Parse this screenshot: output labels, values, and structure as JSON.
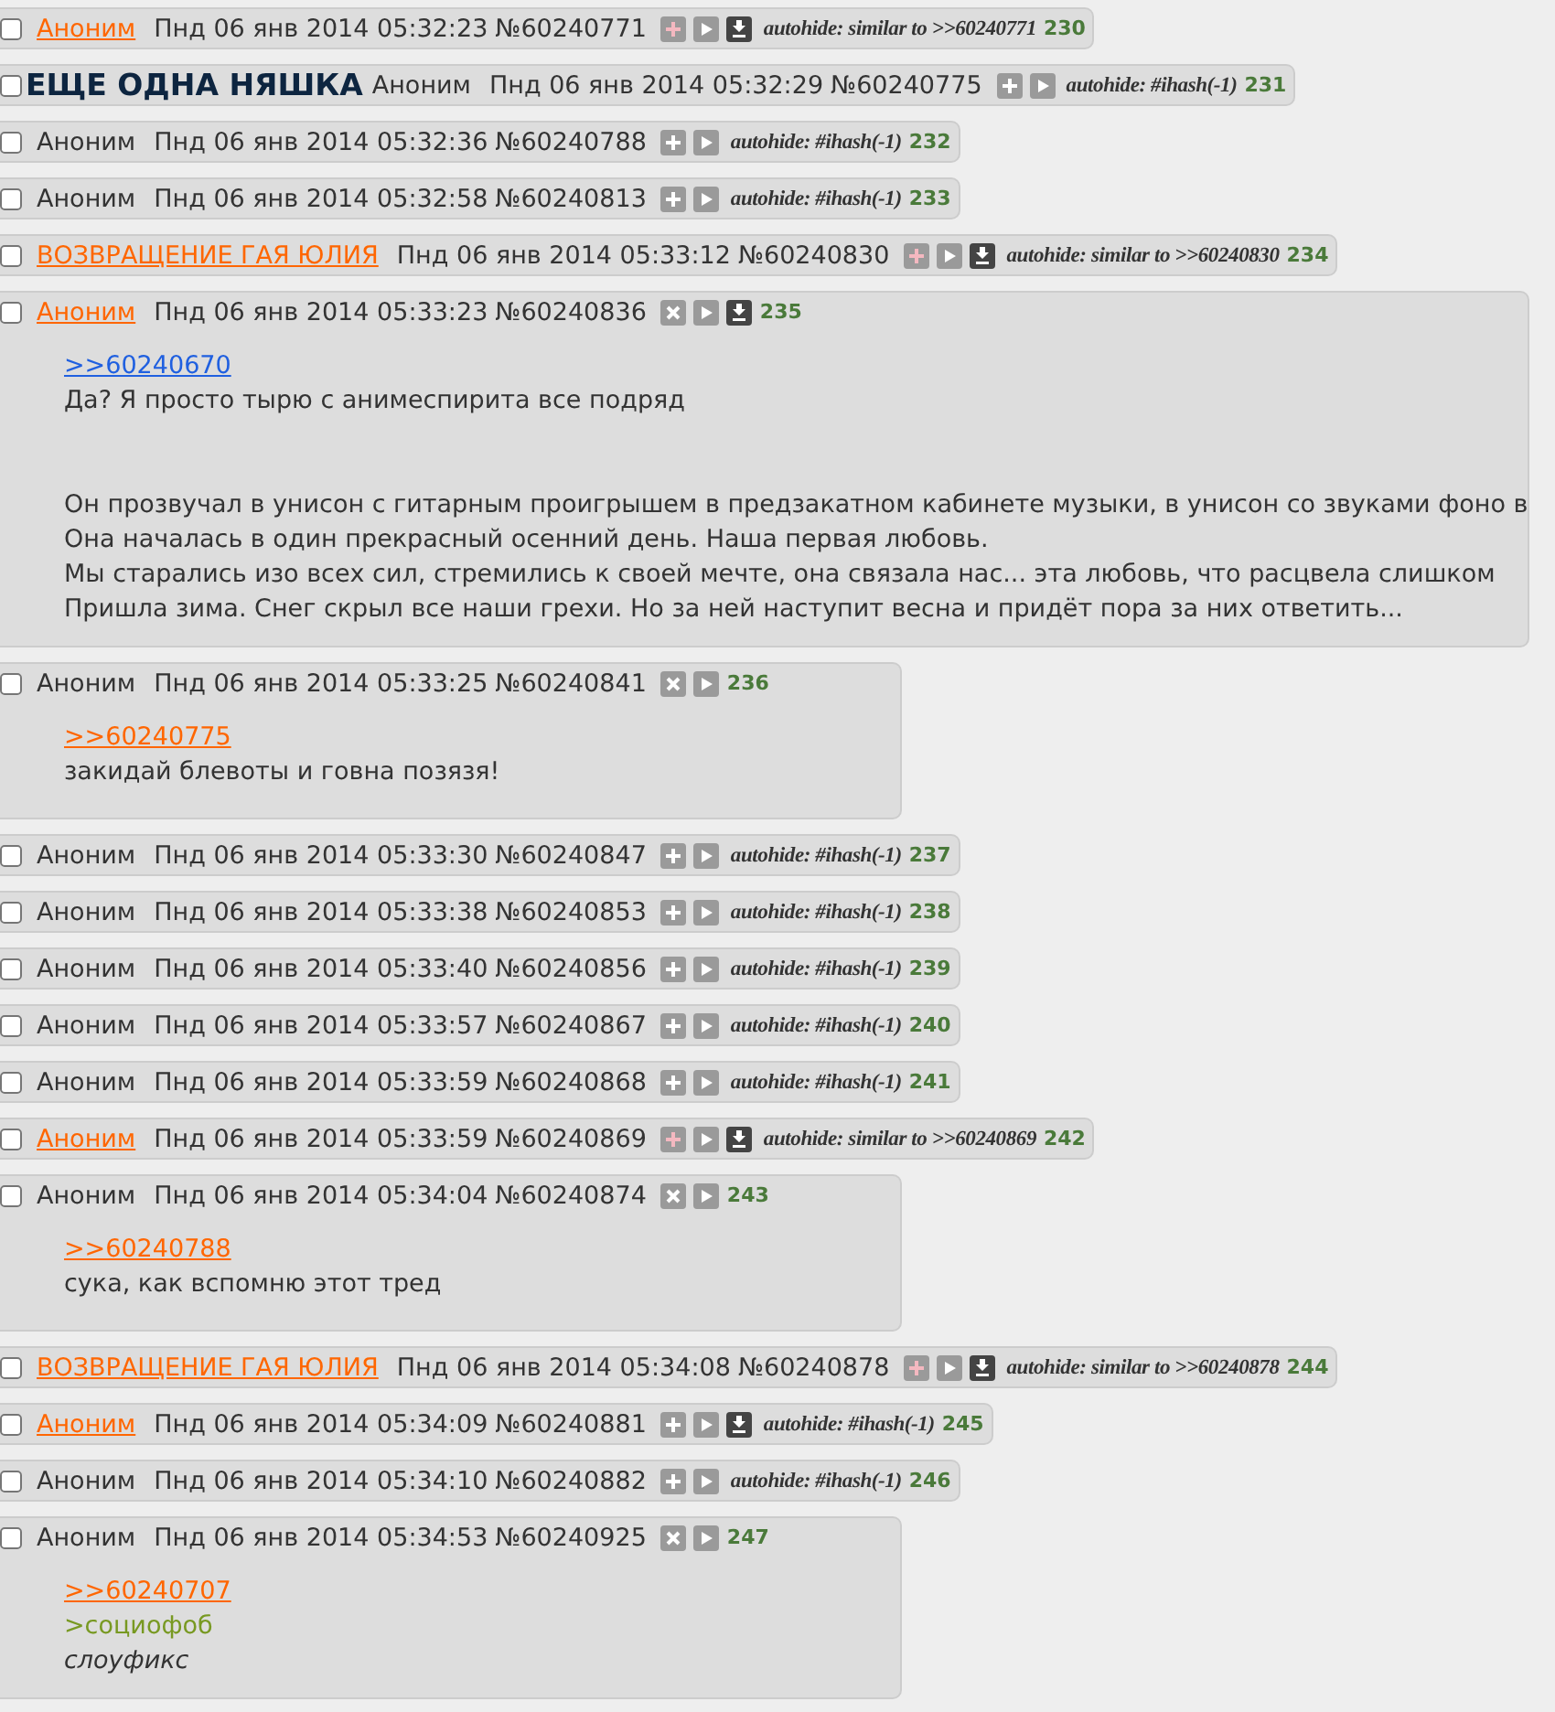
{
  "posts": [
    {
      "checked": false,
      "name": "Аноним",
      "name_link": true,
      "date": "Пнд 06 янв 2014 05:32:23",
      "number": "№60240771",
      "buttons": [
        {
          "kind": "add-marked"
        },
        {
          "kind": "play"
        },
        {
          "kind": "download"
        }
      ],
      "autohide": "autohide: similar to >>60240771",
      "index": "230"
    },
    {
      "checked": false,
      "subject": "ЕЩЕ ОДНА НЯШКА",
      "name": "Аноним",
      "name_link": false,
      "date": "Пнд 06 янв 2014 05:32:29",
      "number": "№60240775",
      "buttons": [
        {
          "kind": "add"
        },
        {
          "kind": "play"
        }
      ],
      "autohide": "autohide: #ihash(-1)",
      "index": "231"
    },
    {
      "checked": false,
      "name": "Аноним",
      "name_link": false,
      "date": "Пнд 06 янв 2014 05:32:36",
      "number": "№60240788",
      "buttons": [
        {
          "kind": "add"
        },
        {
          "kind": "play"
        }
      ],
      "autohide": "autohide: #ihash(-1)",
      "index": "232"
    },
    {
      "checked": false,
      "name": "Аноним",
      "name_link": false,
      "date": "Пнд 06 янв 2014 05:32:58",
      "number": "№60240813",
      "buttons": [
        {
          "kind": "add"
        },
        {
          "kind": "play"
        }
      ],
      "autohide": "autohide: #ihash(-1)",
      "index": "233"
    },
    {
      "checked": false,
      "name": "ВОЗВРАЩЕНИЕ ГАЯ ЮЛИЯ",
      "name_link": true,
      "date": "Пнд 06 янв 2014 05:33:12",
      "number": "№60240830",
      "buttons": [
        {
          "kind": "add-marked"
        },
        {
          "kind": "play"
        },
        {
          "kind": "download"
        }
      ],
      "autohide": "autohide: similar to >>60240830",
      "index": "234"
    },
    {
      "checked": false,
      "name": "Аноним",
      "name_link": true,
      "date": "Пнд 06 янв 2014 05:33:23",
      "number": "№60240836",
      "buttons": [
        {
          "kind": "remove"
        },
        {
          "kind": "play"
        },
        {
          "kind": "download"
        }
      ],
      "index": "235",
      "body": [
        [
          {
            "kind": "reply-link",
            "text": ">>60240670",
            "visited": false
          },
          {
            "kind": "text",
            "text": "Да? Я просто тырю с анимеспирита все подряд"
          }
        ],
        [
          {
            "kind": "text",
            "text": "Он прозвучал в унисон с гитарным проигрышем в предзакатном кабинете музыки, в унисон со звуками фоно в"
          },
          {
            "kind": "text",
            "text": "Она началась в один прекрасный осенний день. Наша первая любовь."
          },
          {
            "kind": "text",
            "text": "Мы старались изо всех сил, стремились к своей мечте, она связала нас... эта любовь, что расцвела слишком"
          },
          {
            "kind": "text",
            "text": "Пришла зима. Снег скрыл все наши грехи. Но за ней наступит весна и придёт пора за них ответить..."
          }
        ]
      ]
    },
    {
      "checked": false,
      "name": "Аноним",
      "name_link": false,
      "date": "Пнд 06 янв 2014 05:33:25",
      "number": "№60240841",
      "buttons": [
        {
          "kind": "remove"
        },
        {
          "kind": "play"
        }
      ],
      "index": "236",
      "body": [
        [
          {
            "kind": "reply-link",
            "text": ">>60240775",
            "visited": true
          },
          {
            "kind": "text",
            "text": "закидай блевоты и говна позязя!"
          }
        ]
      ]
    },
    {
      "checked": false,
      "name": "Аноним",
      "name_link": false,
      "date": "Пнд 06 янв 2014 05:33:30",
      "number": "№60240847",
      "buttons": [
        {
          "kind": "add"
        },
        {
          "kind": "play"
        }
      ],
      "autohide": "autohide: #ihash(-1)",
      "index": "237"
    },
    {
      "checked": false,
      "name": "Аноним",
      "name_link": false,
      "date": "Пнд 06 янв 2014 05:33:38",
      "number": "№60240853",
      "buttons": [
        {
          "kind": "add"
        },
        {
          "kind": "play"
        }
      ],
      "autohide": "autohide: #ihash(-1)",
      "index": "238"
    },
    {
      "checked": false,
      "name": "Аноним",
      "name_link": false,
      "date": "Пнд 06 янв 2014 05:33:40",
      "number": "№60240856",
      "buttons": [
        {
          "kind": "add"
        },
        {
          "kind": "play"
        }
      ],
      "autohide": "autohide: #ihash(-1)",
      "index": "239"
    },
    {
      "checked": false,
      "name": "Аноним",
      "name_link": false,
      "date": "Пнд 06 янв 2014 05:33:57",
      "number": "№60240867",
      "buttons": [
        {
          "kind": "add"
        },
        {
          "kind": "play"
        }
      ],
      "autohide": "autohide: #ihash(-1)",
      "index": "240"
    },
    {
      "checked": false,
      "name": "Аноним",
      "name_link": false,
      "date": "Пнд 06 янв 2014 05:33:59",
      "number": "№60240868",
      "buttons": [
        {
          "kind": "add"
        },
        {
          "kind": "play"
        }
      ],
      "autohide": "autohide: #ihash(-1)",
      "index": "241"
    },
    {
      "checked": false,
      "name": "Аноним",
      "name_link": true,
      "date": "Пнд 06 янв 2014 05:33:59",
      "number": "№60240869",
      "buttons": [
        {
          "kind": "add-marked"
        },
        {
          "kind": "play"
        },
        {
          "kind": "download"
        }
      ],
      "autohide": "autohide: similar to >>60240869",
      "index": "242"
    },
    {
      "checked": false,
      "name": "Аноним",
      "name_link": false,
      "date": "Пнд 06 янв 2014 05:34:04",
      "number": "№60240874",
      "buttons": [
        {
          "kind": "remove"
        },
        {
          "kind": "play"
        }
      ],
      "index": "243",
      "body": [
        [
          {
            "kind": "reply-link",
            "text": ">>60240788",
            "visited": true
          },
          {
            "kind": "text",
            "text": "сука, как вспомню этот тред"
          }
        ]
      ]
    },
    {
      "checked": false,
      "name": "ВОЗВРАЩЕНИЕ ГАЯ ЮЛИЯ",
      "name_link": true,
      "date": "Пнд 06 янв 2014 05:34:08",
      "number": "№60240878",
      "buttons": [
        {
          "kind": "add-marked"
        },
        {
          "kind": "play"
        },
        {
          "kind": "download"
        }
      ],
      "autohide": "autohide: similar to >>60240878",
      "index": "244"
    },
    {
      "checked": false,
      "name": "Аноним",
      "name_link": true,
      "date": "Пнд 06 янв 2014 05:34:09",
      "number": "№60240881",
      "buttons": [
        {
          "kind": "add"
        },
        {
          "kind": "play"
        },
        {
          "kind": "download"
        }
      ],
      "autohide": "autohide: #ihash(-1)",
      "index": "245"
    },
    {
      "checked": false,
      "name": "Аноним",
      "name_link": false,
      "date": "Пнд 06 янв 2014 05:34:10",
      "number": "№60240882",
      "buttons": [
        {
          "kind": "add"
        },
        {
          "kind": "play"
        }
      ],
      "autohide": "autohide: #ihash(-1)",
      "index": "246"
    },
    {
      "checked": false,
      "name": "Аноним",
      "name_link": false,
      "date": "Пнд 06 янв 2014 05:34:53",
      "number": "№60240925",
      "buttons": [
        {
          "kind": "remove"
        },
        {
          "kind": "play"
        }
      ],
      "index": "247",
      "body": [
        [
          {
            "kind": "reply-link",
            "text": ">>60240707",
            "visited": true
          },
          {
            "kind": "quote",
            "text": ">социофоб"
          },
          {
            "kind": "italic",
            "text": "слоуфикс"
          }
        ]
      ]
    }
  ]
}
